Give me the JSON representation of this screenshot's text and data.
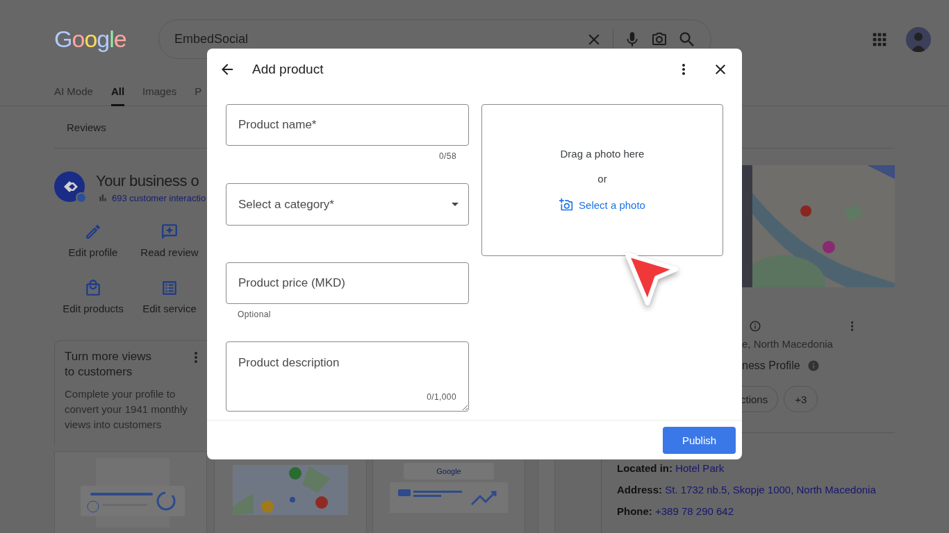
{
  "header": {
    "logo": "Google",
    "search": {
      "value": "EmbedSocial"
    }
  },
  "tabs": [
    {
      "label": "AI Mode",
      "selected": false
    },
    {
      "label": "All",
      "selected": true
    },
    {
      "label": "Images",
      "selected": false
    },
    {
      "label": "P",
      "selected": false
    }
  ],
  "subnav": {
    "label": "Reviews"
  },
  "business": {
    "title": "Your business o",
    "interactions": "693 customer interactio"
  },
  "actions": [
    {
      "kind": "edit",
      "label": "Edit profile"
    },
    {
      "kind": "reviews",
      "label": "Read review"
    },
    {
      "kind": "products",
      "label": "Edit products"
    },
    {
      "kind": "services",
      "label": "Edit service"
    }
  ],
  "promo_card": {
    "title": "Turn more views to customers",
    "text": "Complete your profile to convert your 1941 monthly views into customers"
  },
  "illustrations": [
    {
      "kind": "profile"
    },
    {
      "kind": "map"
    },
    {
      "kind": "search",
      "logo": "Google"
    },
    {
      "kind": "blank"
    }
  ],
  "profile_panel": {
    "location": "e, North Macedonia",
    "claim": "ness Profile",
    "chips": [
      "ctions",
      "+3"
    ]
  },
  "details": [
    {
      "label": "Located in:",
      "value": "Hotel Park"
    },
    {
      "label": "Address:",
      "value": "St. 1732 nb.5, Skopje 1000, North Macedonia"
    },
    {
      "label": "Phone:",
      "value": "+389 78 290 642"
    }
  ],
  "dialog": {
    "title": "Add product",
    "fields": [
      {
        "kind": "text",
        "placeholder": "Product name*",
        "counter": "0/58"
      },
      {
        "kind": "select",
        "placeholder": "Select a category*"
      },
      {
        "kind": "text",
        "placeholder": "Product price (MKD)",
        "helper": "Optional"
      },
      {
        "kind": "textarea",
        "placeholder": "Product description",
        "counter": "0/1,000"
      }
    ],
    "photo": {
      "hint": "Drag a photo here",
      "or": "or",
      "link": "Select a photo"
    },
    "publish": "Publish"
  }
}
